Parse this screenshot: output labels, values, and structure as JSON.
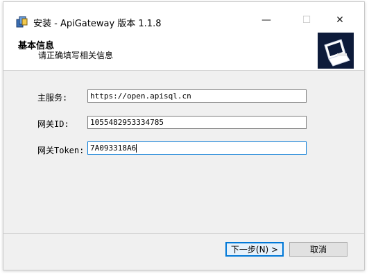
{
  "window": {
    "title": "安装 - ApiGateway 版本 1.1.8"
  },
  "titlebar": {
    "minimize": "—",
    "maximize": "☐",
    "close": "✕"
  },
  "header": {
    "title": "基本信息",
    "subtitle": "请正确填写相关信息"
  },
  "form": {
    "fields": [
      {
        "label": "主服务:",
        "value": "https://open.apisql.cn"
      },
      {
        "label": "网关ID:",
        "value": "1055482953334785"
      },
      {
        "label": "网关Token:",
        "value": "7A093318A6"
      }
    ]
  },
  "buttons": {
    "next": "下一步(N) >",
    "cancel": "取消"
  },
  "colors": {
    "accent": "#0078d7",
    "window_bg": "#f0f0f0"
  }
}
